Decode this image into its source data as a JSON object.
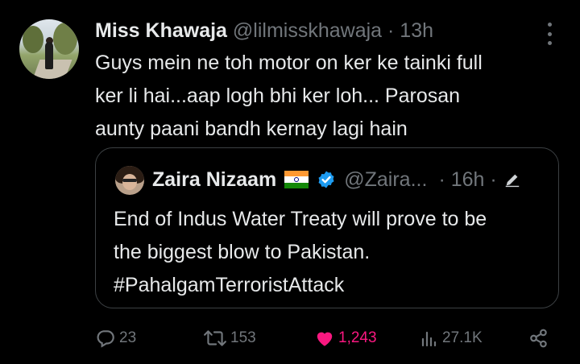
{
  "tweet": {
    "author_name": "Miss Khawaja",
    "author_handle": "@lilmisskhawaja",
    "separator": "·",
    "time": "13h",
    "text": "Guys mein ne toh motor on ker ke tainki full\nker li hai...aap logh bhi ker loh... Parosan\naunty paani bandh kernay lagi hain"
  },
  "quote": {
    "author_name": "Zaira Nizaam",
    "flag_icon": "india-flag-icon",
    "verified_icon": "verified-badge-icon",
    "author_handle": "@Zaira...",
    "time": "· 16h ·",
    "text": "End of Indus Water Treaty will prove to be\nthe biggest blow to Pakistan.\n#PahalgamTerroristAttack"
  },
  "actions": {
    "replies": "23",
    "reposts": "153",
    "likes": "1,243",
    "views": "27.1K",
    "like_color": "#f91880",
    "icon_color": "#71767b"
  },
  "colors": {
    "background": "#000000",
    "text": "#e7e9ea",
    "muted": "#71767b",
    "verified": "#1d9bf0",
    "border": "#3c4043"
  }
}
